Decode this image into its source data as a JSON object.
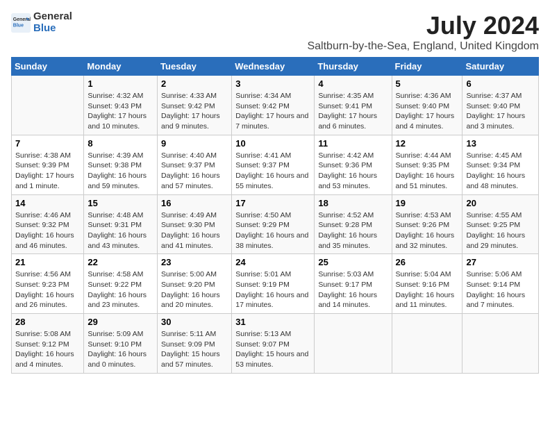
{
  "logo": {
    "general": "General",
    "blue": "Blue"
  },
  "title": "July 2024",
  "subtitle": "Saltburn-by-the-Sea, England, United Kingdom",
  "weekdays": [
    "Sunday",
    "Monday",
    "Tuesday",
    "Wednesday",
    "Thursday",
    "Friday",
    "Saturday"
  ],
  "weeks": [
    [
      {
        "day": "",
        "sunrise": "",
        "sunset": "",
        "daylight": ""
      },
      {
        "day": "1",
        "sunrise": "Sunrise: 4:32 AM",
        "sunset": "Sunset: 9:43 PM",
        "daylight": "Daylight: 17 hours and 10 minutes."
      },
      {
        "day": "2",
        "sunrise": "Sunrise: 4:33 AM",
        "sunset": "Sunset: 9:42 PM",
        "daylight": "Daylight: 17 hours and 9 minutes."
      },
      {
        "day": "3",
        "sunrise": "Sunrise: 4:34 AM",
        "sunset": "Sunset: 9:42 PM",
        "daylight": "Daylight: 17 hours and 7 minutes."
      },
      {
        "day": "4",
        "sunrise": "Sunrise: 4:35 AM",
        "sunset": "Sunset: 9:41 PM",
        "daylight": "Daylight: 17 hours and 6 minutes."
      },
      {
        "day": "5",
        "sunrise": "Sunrise: 4:36 AM",
        "sunset": "Sunset: 9:40 PM",
        "daylight": "Daylight: 17 hours and 4 minutes."
      },
      {
        "day": "6",
        "sunrise": "Sunrise: 4:37 AM",
        "sunset": "Sunset: 9:40 PM",
        "daylight": "Daylight: 17 hours and 3 minutes."
      }
    ],
    [
      {
        "day": "7",
        "sunrise": "Sunrise: 4:38 AM",
        "sunset": "Sunset: 9:39 PM",
        "daylight": "Daylight: 17 hours and 1 minute."
      },
      {
        "day": "8",
        "sunrise": "Sunrise: 4:39 AM",
        "sunset": "Sunset: 9:38 PM",
        "daylight": "Daylight: 16 hours and 59 minutes."
      },
      {
        "day": "9",
        "sunrise": "Sunrise: 4:40 AM",
        "sunset": "Sunset: 9:37 PM",
        "daylight": "Daylight: 16 hours and 57 minutes."
      },
      {
        "day": "10",
        "sunrise": "Sunrise: 4:41 AM",
        "sunset": "Sunset: 9:37 PM",
        "daylight": "Daylight: 16 hours and 55 minutes."
      },
      {
        "day": "11",
        "sunrise": "Sunrise: 4:42 AM",
        "sunset": "Sunset: 9:36 PM",
        "daylight": "Daylight: 16 hours and 53 minutes."
      },
      {
        "day": "12",
        "sunrise": "Sunrise: 4:44 AM",
        "sunset": "Sunset: 9:35 PM",
        "daylight": "Daylight: 16 hours and 51 minutes."
      },
      {
        "day": "13",
        "sunrise": "Sunrise: 4:45 AM",
        "sunset": "Sunset: 9:34 PM",
        "daylight": "Daylight: 16 hours and 48 minutes."
      }
    ],
    [
      {
        "day": "14",
        "sunrise": "Sunrise: 4:46 AM",
        "sunset": "Sunset: 9:32 PM",
        "daylight": "Daylight: 16 hours and 46 minutes."
      },
      {
        "day": "15",
        "sunrise": "Sunrise: 4:48 AM",
        "sunset": "Sunset: 9:31 PM",
        "daylight": "Daylight: 16 hours and 43 minutes."
      },
      {
        "day": "16",
        "sunrise": "Sunrise: 4:49 AM",
        "sunset": "Sunset: 9:30 PM",
        "daylight": "Daylight: 16 hours and 41 minutes."
      },
      {
        "day": "17",
        "sunrise": "Sunrise: 4:50 AM",
        "sunset": "Sunset: 9:29 PM",
        "daylight": "Daylight: 16 hours and 38 minutes."
      },
      {
        "day": "18",
        "sunrise": "Sunrise: 4:52 AM",
        "sunset": "Sunset: 9:28 PM",
        "daylight": "Daylight: 16 hours and 35 minutes."
      },
      {
        "day": "19",
        "sunrise": "Sunrise: 4:53 AM",
        "sunset": "Sunset: 9:26 PM",
        "daylight": "Daylight: 16 hours and 32 minutes."
      },
      {
        "day": "20",
        "sunrise": "Sunrise: 4:55 AM",
        "sunset": "Sunset: 9:25 PM",
        "daylight": "Daylight: 16 hours and 29 minutes."
      }
    ],
    [
      {
        "day": "21",
        "sunrise": "Sunrise: 4:56 AM",
        "sunset": "Sunset: 9:23 PM",
        "daylight": "Daylight: 16 hours and 26 minutes."
      },
      {
        "day": "22",
        "sunrise": "Sunrise: 4:58 AM",
        "sunset": "Sunset: 9:22 PM",
        "daylight": "Daylight: 16 hours and 23 minutes."
      },
      {
        "day": "23",
        "sunrise": "Sunrise: 5:00 AM",
        "sunset": "Sunset: 9:20 PM",
        "daylight": "Daylight: 16 hours and 20 minutes."
      },
      {
        "day": "24",
        "sunrise": "Sunrise: 5:01 AM",
        "sunset": "Sunset: 9:19 PM",
        "daylight": "Daylight: 16 hours and 17 minutes."
      },
      {
        "day": "25",
        "sunrise": "Sunrise: 5:03 AM",
        "sunset": "Sunset: 9:17 PM",
        "daylight": "Daylight: 16 hours and 14 minutes."
      },
      {
        "day": "26",
        "sunrise": "Sunrise: 5:04 AM",
        "sunset": "Sunset: 9:16 PM",
        "daylight": "Daylight: 16 hours and 11 minutes."
      },
      {
        "day": "27",
        "sunrise": "Sunrise: 5:06 AM",
        "sunset": "Sunset: 9:14 PM",
        "daylight": "Daylight: 16 hours and 7 minutes."
      }
    ],
    [
      {
        "day": "28",
        "sunrise": "Sunrise: 5:08 AM",
        "sunset": "Sunset: 9:12 PM",
        "daylight": "Daylight: 16 hours and 4 minutes."
      },
      {
        "day": "29",
        "sunrise": "Sunrise: 5:09 AM",
        "sunset": "Sunset: 9:10 PM",
        "daylight": "Daylight: 16 hours and 0 minutes."
      },
      {
        "day": "30",
        "sunrise": "Sunrise: 5:11 AM",
        "sunset": "Sunset: 9:09 PM",
        "daylight": "Daylight: 15 hours and 57 minutes."
      },
      {
        "day": "31",
        "sunrise": "Sunrise: 5:13 AM",
        "sunset": "Sunset: 9:07 PM",
        "daylight": "Daylight: 15 hours and 53 minutes."
      },
      {
        "day": "",
        "sunrise": "",
        "sunset": "",
        "daylight": ""
      },
      {
        "day": "",
        "sunrise": "",
        "sunset": "",
        "daylight": ""
      },
      {
        "day": "",
        "sunrise": "",
        "sunset": "",
        "daylight": ""
      }
    ]
  ]
}
